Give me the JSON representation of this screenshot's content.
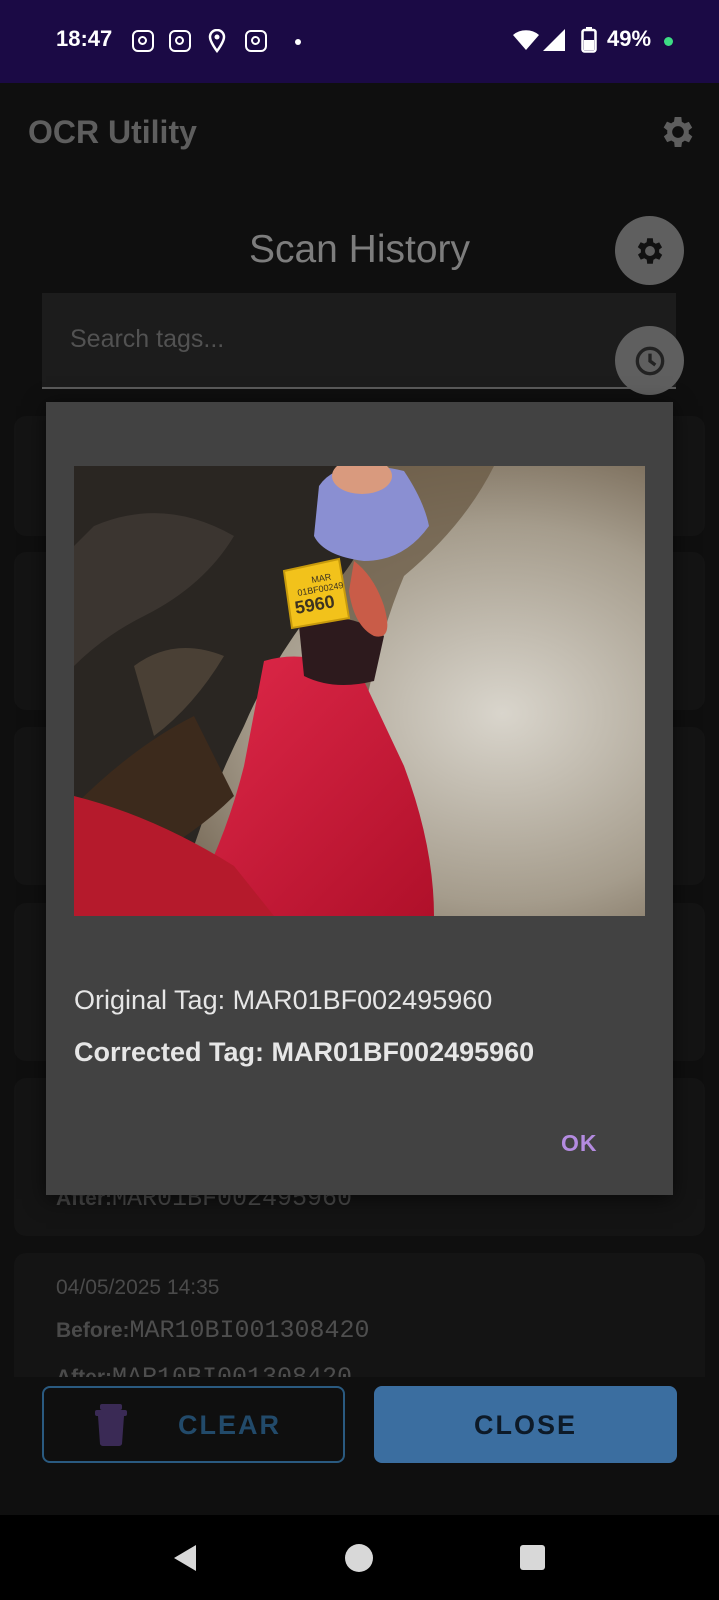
{
  "status_bar": {
    "time": "18:47",
    "battery": "49%"
  },
  "app_bar": {
    "title": "OCR Utility",
    "settings_icon": "gear-icon"
  },
  "screen": {
    "heading": "Scan History",
    "search_placeholder": "Search tags...",
    "fab_settings_icon": "gear-icon",
    "fab_history_icon": "clock-icon"
  },
  "history": {
    "before_label": "Before:",
    "after_label": "After:",
    "visible_after_value": "MAR01BF002495960",
    "last_item": {
      "timestamp": "04/05/2025 14:35",
      "before": "MAR10BI001308420",
      "after": "MAR10BI001308420"
    }
  },
  "dialog": {
    "image_description_icon": "ear-tag-photo",
    "tag_print_line1": "MAR",
    "tag_print_line2": "01BF00249",
    "tag_print_line3": "5960",
    "original_tag": "Original Tag: MAR01BF002495960",
    "corrected_tag": "Corrected Tag: MAR01BF002495960",
    "ok_label": "OK"
  },
  "bottom_buttons": {
    "clear_label": "CLEAR",
    "close_label": "CLOSE",
    "clear_icon": "trash-icon"
  },
  "colors": {
    "status_bar": "#1b0a45",
    "accent_purple": "#b48be0",
    "close_button": "#3b6ea0"
  }
}
